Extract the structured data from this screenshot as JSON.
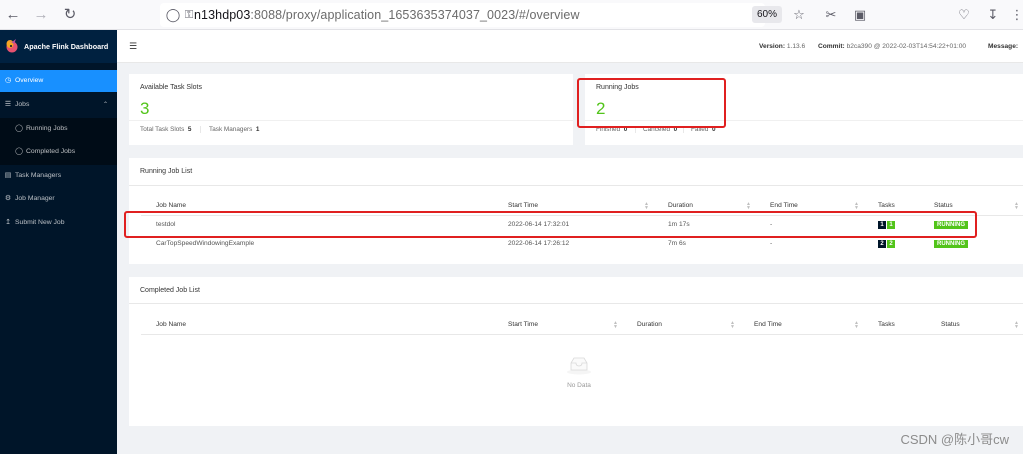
{
  "browser": {
    "url_host": "n13hdp03",
    "url_rest": ":8088/proxy/application_1653635374037_0023/#/overview",
    "zoom": "60%"
  },
  "sidebar": {
    "brand": "Apache Flink Dashboard",
    "items": [
      {
        "label": "Overview",
        "icon": "dashboard-icon"
      },
      {
        "label": "Jobs",
        "icon": "bars-icon"
      },
      {
        "label": "Running Jobs",
        "icon": "play-circle-icon"
      },
      {
        "label": "Completed Jobs",
        "icon": "check-circle-icon"
      },
      {
        "label": "Task Managers",
        "icon": "schedule-icon"
      },
      {
        "label": "Job Manager",
        "icon": "build-icon"
      },
      {
        "label": "Submit New Job",
        "icon": "upload-icon"
      }
    ]
  },
  "header": {
    "version_label": "Version:",
    "version": "1.13.6",
    "commit_label": "Commit:",
    "commit": "b2ca390 @ 2022-02-03T14:54:22+01:00",
    "message_label": "Message:"
  },
  "stats": {
    "slots_title": "Available Task Slots",
    "slots_value": "3",
    "total_slots_label": "Total Task Slots",
    "total_slots_value": "5",
    "task_managers_label": "Task Managers",
    "task_managers_value": "1",
    "running_title": "Running Jobs",
    "running_value": "2",
    "finished_label": "Finished",
    "finished_value": "0",
    "canceled_label": "Canceled",
    "canceled_value": "0",
    "failed_label": "Failed",
    "failed_value": "0"
  },
  "running_list": {
    "title": "Running Job List",
    "columns": [
      "Job Name",
      "Start Time",
      "Duration",
      "End Time",
      "Tasks",
      "Status"
    ],
    "rows": [
      {
        "name": "testdol",
        "start": "2022-06-14 17:32:01",
        "duration": "1m 17s",
        "end": "-",
        "task_total": "1",
        "task_running": "1",
        "status": "RUNNING"
      },
      {
        "name": "CarTopSpeedWindowingExample",
        "start": "2022-06-14 17:26:12",
        "duration": "7m 6s",
        "end": "-",
        "task_total": "2",
        "task_running": "2",
        "status": "RUNNING"
      }
    ]
  },
  "completed_list": {
    "title": "Completed Job List",
    "columns": [
      "Job Name",
      "Start Time",
      "Duration",
      "End Time",
      "Tasks",
      "Status"
    ],
    "empty_text": "No Data"
  },
  "watermark": "CSDN @陈小哥cw",
  "colors": {
    "sidebar_bg": "#001529",
    "active_menu": "#1890ff",
    "success_green": "#52c41a",
    "highlight_red": "#e02020"
  }
}
